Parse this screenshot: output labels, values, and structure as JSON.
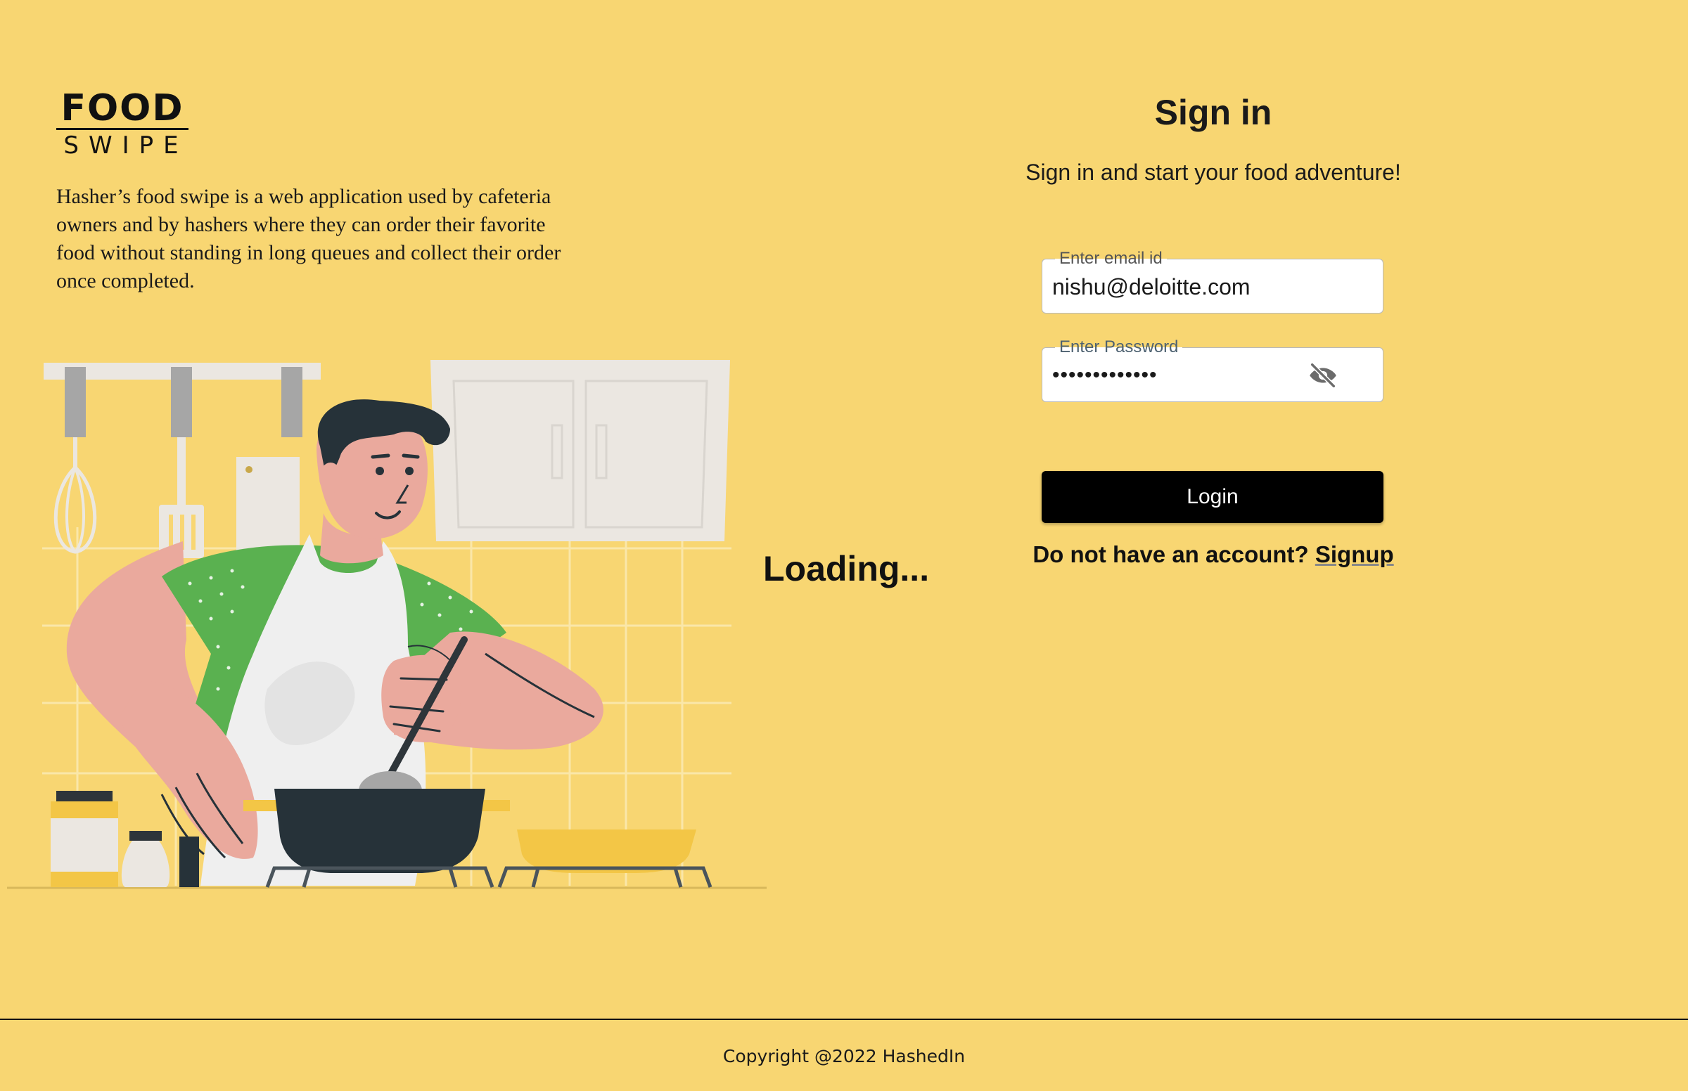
{
  "brand": {
    "logo_top": "FOOD",
    "logo_bottom": "SWIPE"
  },
  "description": "Hasher’s food swipe is a web application used by cafeteria owners and by hashers where they can order their favorite food without standing in long queues and collect their order once completed.",
  "loading_text": "Loading...",
  "signin": {
    "title": "Sign in",
    "subtitle": "Sign in and start your food adventure!",
    "email": {
      "label": "Enter email id",
      "value": "nishu@deloitte.com"
    },
    "password": {
      "label": "Enter Password",
      "value": "•••••••••••••",
      "toggle_icon": "eye-off-icon"
    },
    "login_label": "Login",
    "account_prompt": "Do not have an account?",
    "signup_label": "Signup"
  },
  "footer": {
    "copyright": "Copyright @2022 HashedIn"
  },
  "colors": {
    "background": "#f8d672",
    "button": "#000000",
    "shirt": "#5ab150",
    "skin": "#eaa99d"
  }
}
